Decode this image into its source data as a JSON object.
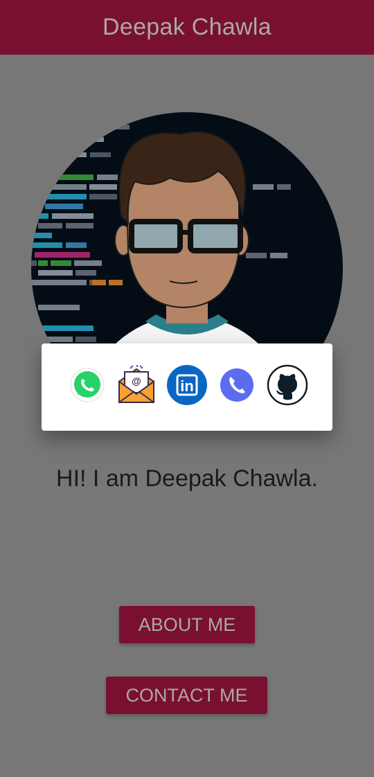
{
  "app_bar": {
    "title": "Deepak Chawla"
  },
  "profile": {
    "avatar_icon": "developer-avatar"
  },
  "share_sheet": {
    "icons": [
      "whatsapp-icon",
      "email-icon",
      "linkedin-icon",
      "phone-icon",
      "github-icon"
    ],
    "linkedin_glyph": "in",
    "email_glyph": "@"
  },
  "greeting": "HI! I am Deepak Chawla.",
  "buttons": {
    "about": "ABOUT ME",
    "contact": "CONTACT ME"
  },
  "colors": {
    "primary": "#7a1030",
    "scrim": "#777777",
    "button_text": "#a9a9a9",
    "whatsapp": "#25d366",
    "linkedin": "#0a66c2",
    "phone": "#5b6cf2",
    "github": "#0d1e2a"
  }
}
